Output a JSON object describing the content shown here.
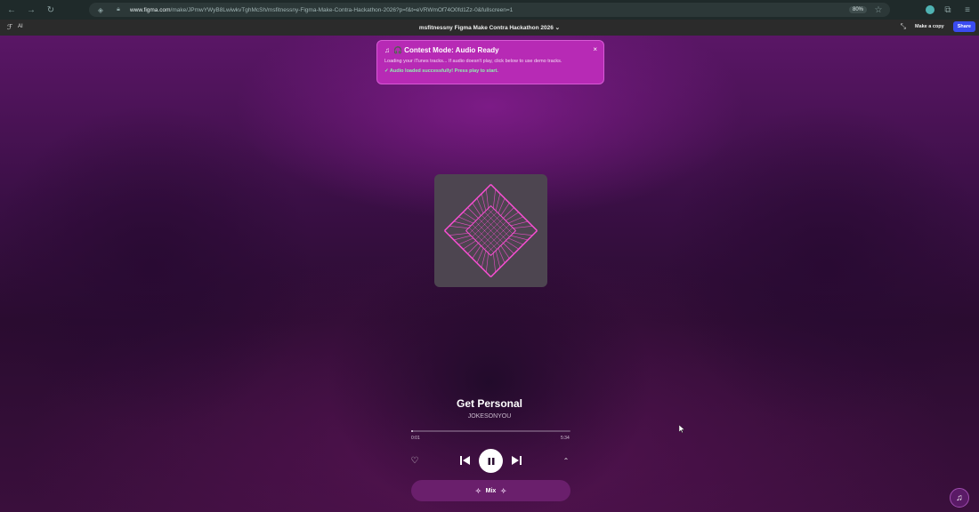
{
  "browser": {
    "url_host": "www.figma.com",
    "url_path": "/make/JPmwYWyB8LwiwkvTghMcSh/msfitnessny-Figma-Make-Contra-Hackathon-2026?p=f&t=eVRWmOf74O0fd1Zz-0&fullscreen=1",
    "zoom": "80%"
  },
  "figma": {
    "ai_label": "AI",
    "file_title": "msfitnessny Figma Make Contra Hackathon 2026",
    "make_copy_label": "Make a copy",
    "share_label": "Share"
  },
  "toast": {
    "title": "🎧 Contest Mode: Audio Ready",
    "message": "Loading your iTunes tracks... If audio doesn't play, click below to use demo tracks.",
    "success": "✓ Audio loaded successfully! Press play to start."
  },
  "player": {
    "title": "Get Personal",
    "artist": "JOKESONYOU",
    "current_time": "0:01",
    "total_time": "5:34",
    "progress": 0.003,
    "mix_label": "Mix"
  },
  "colors": {
    "accent": "#b72ab5",
    "share_button": "#3a4bf0",
    "art_line": "#ff4fd8"
  }
}
